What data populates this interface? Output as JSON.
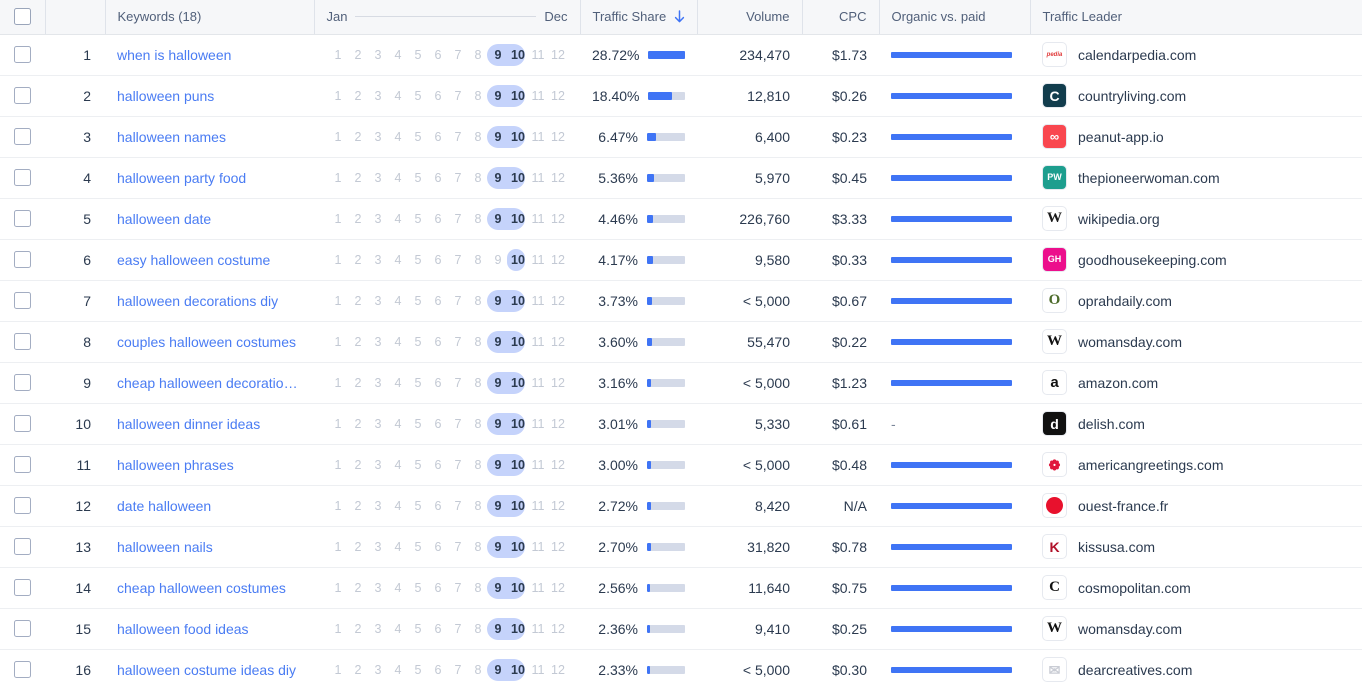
{
  "table": {
    "columns": {
      "select_all": "",
      "position": "",
      "keywords": "Keywords (18)",
      "season_start": "Jan",
      "season_end": "Dec",
      "traffic_share": "Traffic Share",
      "sort_icon": "arrow-down-icon",
      "volume": "Volume",
      "cpc": "CPC",
      "organic_vs_paid": "Organic vs. paid",
      "traffic_leader": "Traffic Leader"
    },
    "months": [
      "1",
      "2",
      "3",
      "4",
      "5",
      "6",
      "7",
      "8",
      "9",
      "10",
      "11",
      "12"
    ],
    "rows": [
      {
        "pos": "1",
        "keyword": "when is halloween",
        "hot_months": [
          "9",
          "10"
        ],
        "share": "28.72%",
        "share_pct": 28.72,
        "volume": "234,470",
        "cpc": "$1.73",
        "organic": "bar",
        "leader": "calendarpedia.com",
        "favicon": {
          "type": "calendarpedia",
          "text": "pedia",
          "bg": "#ffffff",
          "fg": "#e03a3a"
        }
      },
      {
        "pos": "2",
        "keyword": "halloween puns",
        "hot_months": [
          "9",
          "10"
        ],
        "share": "18.40%",
        "share_pct": 18.4,
        "volume": "12,810",
        "cpc": "$0.26",
        "organic": "bar",
        "leader": "countryliving.com",
        "favicon": {
          "type": "letter",
          "text": "C",
          "bg": "#123d4d",
          "fg": "#ffffff"
        }
      },
      {
        "pos": "3",
        "keyword": "halloween names",
        "hot_months": [
          "9",
          "10"
        ],
        "share": "6.47%",
        "share_pct": 6.47,
        "volume": "6,400",
        "cpc": "$0.23",
        "organic": "bar",
        "leader": "peanut-app.io",
        "favicon": {
          "type": "peanut",
          "text": "∞",
          "bg": "#f9474f",
          "fg": "#ffffff"
        }
      },
      {
        "pos": "4",
        "keyword": "halloween party food",
        "hot_months": [
          "9",
          "10"
        ],
        "share": "5.36%",
        "share_pct": 5.36,
        "volume": "5,970",
        "cpc": "$0.45",
        "organic": "bar",
        "leader": "thepioneerwoman.com",
        "favicon": {
          "type": "letter",
          "text": "PW",
          "bg": "#1d9e8e",
          "fg": "#ffffff"
        }
      },
      {
        "pos": "5",
        "keyword": "halloween date",
        "hot_months": [
          "9",
          "10"
        ],
        "share": "4.46%",
        "share_pct": 4.46,
        "volume": "226,760",
        "cpc": "$3.33",
        "organic": "bar",
        "leader": "wikipedia.org",
        "favicon": {
          "type": "serif",
          "text": "W",
          "bg": "#ffffff",
          "fg": "#1a1a1a"
        }
      },
      {
        "pos": "6",
        "keyword": "easy halloween costume",
        "hot_months": [
          "10"
        ],
        "share": "4.17%",
        "share_pct": 4.17,
        "volume": "9,580",
        "cpc": "$0.33",
        "organic": "bar",
        "leader": "goodhousekeeping.com",
        "favicon": {
          "type": "letter",
          "text": "GH",
          "bg": "#ec0f8c",
          "fg": "#ffffff"
        }
      },
      {
        "pos": "7",
        "keyword": "halloween decorations diy",
        "hot_months": [
          "9",
          "10"
        ],
        "share": "3.73%",
        "share_pct": 3.73,
        "volume": "< 5,000",
        "cpc": "$0.67",
        "organic": "bar",
        "leader": "oprahdaily.com",
        "favicon": {
          "type": "serif",
          "text": "O",
          "bg": "#ffffff",
          "fg": "#4c6b2a"
        }
      },
      {
        "pos": "8",
        "keyword": "couples halloween costumes",
        "hot_months": [
          "9",
          "10"
        ],
        "share": "3.60%",
        "share_pct": 3.6,
        "volume": "55,470",
        "cpc": "$0.22",
        "organic": "bar",
        "leader": "womansday.com",
        "favicon": {
          "type": "serif",
          "text": "W",
          "bg": "#ffffff",
          "fg": "#111111"
        }
      },
      {
        "pos": "9",
        "keyword": "cheap halloween decoratio…",
        "hot_months": [
          "9",
          "10"
        ],
        "share": "3.16%",
        "share_pct": 3.16,
        "volume": "< 5,000",
        "cpc": "$1.23",
        "organic": "bar",
        "leader": "amazon.com",
        "favicon": {
          "type": "amazon",
          "text": "a",
          "bg": "#ffffff",
          "fg": "#111111"
        }
      },
      {
        "pos": "10",
        "keyword": "halloween dinner ideas",
        "hot_months": [
          "9",
          "10"
        ],
        "share": "3.01%",
        "share_pct": 3.01,
        "volume": "5,330",
        "cpc": "$0.61",
        "organic": "dash",
        "organic_dash": "-",
        "leader": "delish.com",
        "favicon": {
          "type": "letter",
          "text": "d",
          "bg": "#111111",
          "fg": "#ffffff"
        }
      },
      {
        "pos": "11",
        "keyword": "halloween phrases",
        "hot_months": [
          "9",
          "10"
        ],
        "share": "3.00%",
        "share_pct": 3.0,
        "volume": "< 5,000",
        "cpc": "$0.48",
        "organic": "bar",
        "leader": "americangreetings.com",
        "favicon": {
          "type": "rose",
          "text": "❁",
          "bg": "#ffffff",
          "fg": "#e0173c"
        }
      },
      {
        "pos": "12",
        "keyword": "date halloween",
        "hot_months": [
          "9",
          "10"
        ],
        "share": "2.72%",
        "share_pct": 2.72,
        "volume": "8,420",
        "cpc": "N/A",
        "organic": "bar",
        "leader": "ouest-france.fr",
        "favicon": {
          "type": "circle",
          "text": "",
          "bg": "#e8112d",
          "fg": "#ffffff"
        }
      },
      {
        "pos": "13",
        "keyword": "halloween nails",
        "hot_months": [
          "9",
          "10"
        ],
        "share": "2.70%",
        "share_pct": 2.7,
        "volume": "31,820",
        "cpc": "$0.78",
        "organic": "bar",
        "leader": "kissusa.com",
        "favicon": {
          "type": "letter",
          "text": "K",
          "bg": "#ffffff",
          "fg": "#b0122a"
        }
      },
      {
        "pos": "14",
        "keyword": "cheap halloween costumes",
        "hot_months": [
          "9",
          "10"
        ],
        "share": "2.56%",
        "share_pct": 2.56,
        "volume": "11,640",
        "cpc": "$0.75",
        "organic": "bar",
        "leader": "cosmopolitan.com",
        "favicon": {
          "type": "cosmo",
          "text": "C",
          "bg": "#ffffff",
          "fg": "#111111"
        }
      },
      {
        "pos": "15",
        "keyword": "halloween food ideas",
        "hot_months": [
          "9",
          "10"
        ],
        "share": "2.36%",
        "share_pct": 2.36,
        "volume": "9,410",
        "cpc": "$0.25",
        "organic": "bar",
        "leader": "womansday.com",
        "favicon": {
          "type": "serif",
          "text": "W",
          "bg": "#ffffff",
          "fg": "#111111"
        }
      },
      {
        "pos": "16",
        "keyword": "halloween costume ideas diy",
        "hot_months": [
          "9",
          "10"
        ],
        "share": "2.33%",
        "share_pct": 2.33,
        "volume": "< 5,000",
        "cpc": "$0.30",
        "organic": "bar",
        "leader": "dearcreatives.com",
        "favicon": {
          "type": "butterfly",
          "text": "✉",
          "bg": "#ffffff",
          "fg": "#c9ccd4"
        }
      }
    ]
  },
  "colors": {
    "link": "#4a7cf3",
    "bar_blue": "#3f74f5",
    "bar_track": "#d4dae8",
    "month_highlight": "#c5d3fb",
    "header_bg": "#f6f7f9",
    "text": "#2b3a4f"
  }
}
